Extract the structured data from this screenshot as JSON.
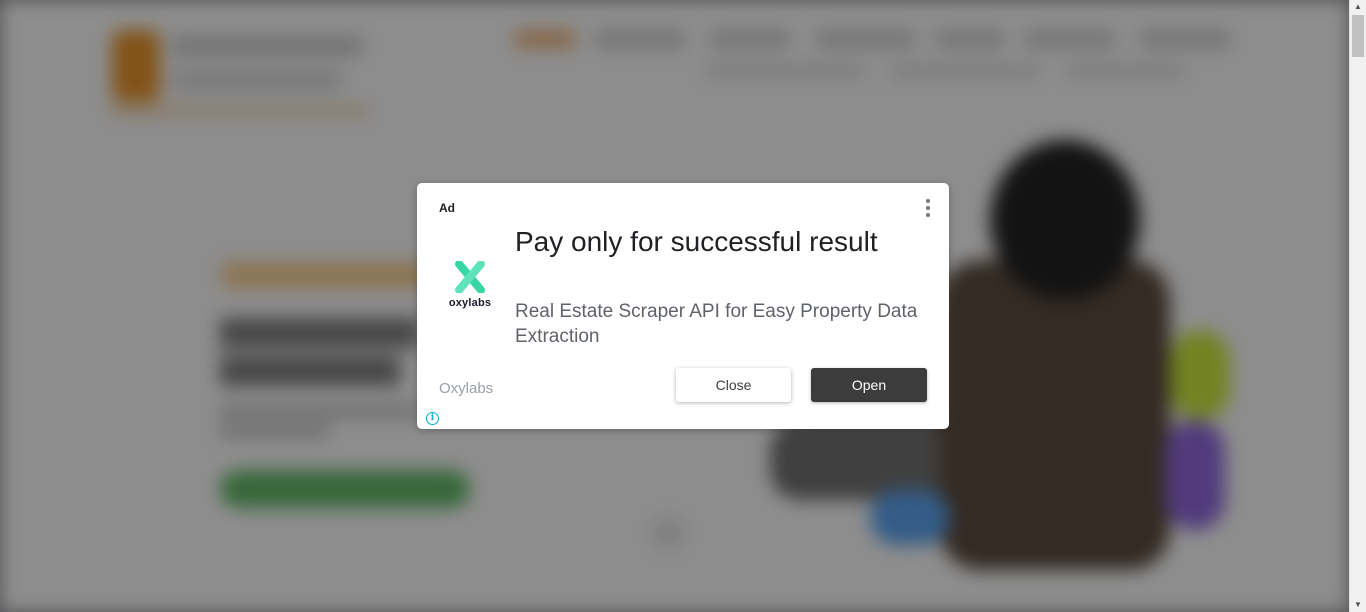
{
  "ad": {
    "label": "Ad",
    "headline": "Pay only for successful result",
    "description": "Real Estate Scraper API for Easy Property Data Extraction",
    "advertiser": "Oxylabs",
    "brand_logo_text": "oxylabs",
    "close_label": "Close",
    "open_label": "Open",
    "info_glyph": "i",
    "menu_icon": "more-vert-icon"
  },
  "colors": {
    "brand_green": "#37d6a4",
    "brand_dark": "#1b1b2f",
    "open_button": "#3c3c3c",
    "info_icon": "#00aecd"
  },
  "scrollbar": {
    "up_glyph": "▲",
    "down_glyph": "▼"
  }
}
